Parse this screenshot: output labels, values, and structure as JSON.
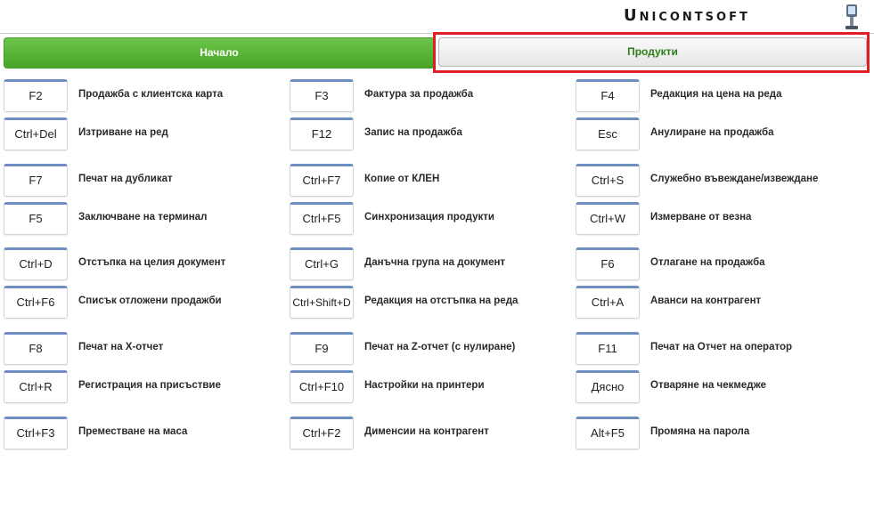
{
  "header": {
    "brand": "Unicontsoft"
  },
  "nav": {
    "start_label": "Начало",
    "products_label": "Продукти"
  },
  "shortcuts": [
    [
      {
        "key": "F2",
        "label": "Продажба с клиентска карта"
      },
      {
        "key": "F3",
        "label": "Фактура за продажба"
      },
      {
        "key": "F4",
        "label": "Редакция на цена на реда"
      }
    ],
    [
      {
        "key": "Ctrl+Del",
        "label": "Изтриване на ред"
      },
      {
        "key": "F12",
        "label": "Запис на продажба"
      },
      {
        "key": "Esc",
        "label": "Анулиране на продажба"
      }
    ],
    [
      {
        "key": "F7",
        "label": "Печат на дубликат"
      },
      {
        "key": "Ctrl+F7",
        "label": "Копие от КЛЕН"
      },
      {
        "key": "Ctrl+S",
        "label": "Служебно въвеждане/извеждане"
      }
    ],
    [
      {
        "key": "F5",
        "label": "Заключване на терминал"
      },
      {
        "key": "Ctrl+F5",
        "label": "Синхронизация продукти"
      },
      {
        "key": "Ctrl+W",
        "label": "Измерване от везна"
      }
    ],
    [
      {
        "key": "Ctrl+D",
        "label": "Отстъпка на целия документ"
      },
      {
        "key": "Ctrl+G",
        "label": "Данъчна група на документ"
      },
      {
        "key": "F6",
        "label": "Отлагане на продажба"
      }
    ],
    [
      {
        "key": "Ctrl+F6",
        "label": "Списък отложени продажби"
      },
      {
        "key": "Ctrl+Shift+D",
        "label": "Редакция на отстъпка на реда"
      },
      {
        "key": "Ctrl+A",
        "label": "Аванси на контрагент"
      }
    ],
    [
      {
        "key": "F8",
        "label": "Печат на X-отчет"
      },
      {
        "key": "F9",
        "label": "Печат на Z-отчет (с нулиране)"
      },
      {
        "key": "F11",
        "label": "Печат на Отчет на оператор"
      }
    ],
    [
      {
        "key": "Ctrl+R",
        "label": "Регистрация на присъствие"
      },
      {
        "key": "Ctrl+F10",
        "label": "Настройки на принтери"
      },
      {
        "key": "Дясно",
        "label": "Отваряне на чекмедже"
      }
    ],
    [
      {
        "key": "Ctrl+F3",
        "label": "Преместване на маса"
      },
      {
        "key": "Ctrl+F2",
        "label": "Дименсии на контрагент"
      },
      {
        "key": "Alt+F5",
        "label": "Промяна на парола"
      }
    ]
  ]
}
